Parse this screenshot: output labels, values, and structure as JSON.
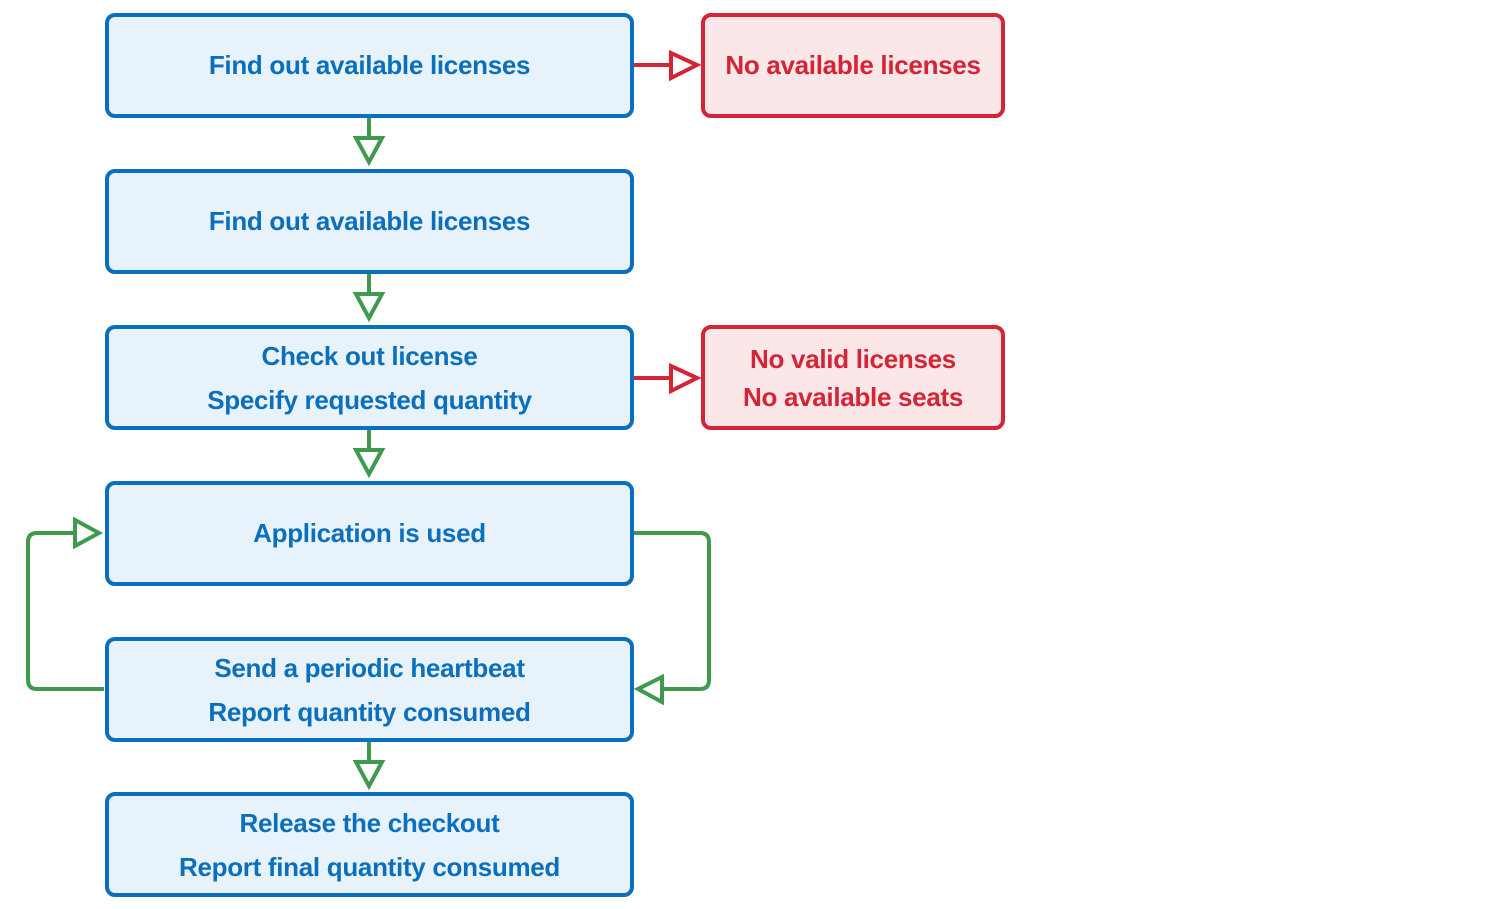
{
  "colors": {
    "step_border": "#0a6fbd",
    "step_fill": "#e8f2fb",
    "step_text": "#0a6fbd",
    "error_border": "#d32537",
    "error_fill": "#fbe6e8",
    "error_text": "#d32537",
    "success_arrow": "#3f9a4f",
    "failure_arrow": "#d32537"
  },
  "steps": [
    {
      "id": "step1",
      "lines": [
        "Find out available licenses"
      ]
    },
    {
      "id": "step2",
      "lines": [
        "Find out available licenses"
      ]
    },
    {
      "id": "step3",
      "lines": [
        "Check out license",
        "Specify requested quantity"
      ]
    },
    {
      "id": "step4",
      "lines": [
        "Application is used"
      ]
    },
    {
      "id": "step5",
      "lines": [
        "Send a periodic heartbeat",
        "Report quantity consumed"
      ]
    },
    {
      "id": "step6",
      "lines": [
        "Release the checkout",
        "Report final quantity consumed"
      ]
    }
  ],
  "errors": [
    {
      "id": "error1",
      "from": "step1",
      "lines": [
        "No available licenses"
      ]
    },
    {
      "id": "error2",
      "from": "step3",
      "lines": [
        "No valid licenses",
        "No available seats"
      ]
    }
  ],
  "connectors": [
    {
      "from": "step1",
      "to": "step2",
      "kind": "success"
    },
    {
      "from": "step2",
      "to": "step3",
      "kind": "success"
    },
    {
      "from": "step3",
      "to": "step4",
      "kind": "success"
    },
    {
      "from": "step4",
      "to": "step5",
      "kind": "success-loop"
    },
    {
      "from": "step5",
      "to": "step4",
      "kind": "success-loop"
    },
    {
      "from": "step5",
      "to": "step6",
      "kind": "success"
    },
    {
      "from": "step1",
      "to": "error1",
      "kind": "failure"
    },
    {
      "from": "step3",
      "to": "error2",
      "kind": "failure"
    }
  ]
}
